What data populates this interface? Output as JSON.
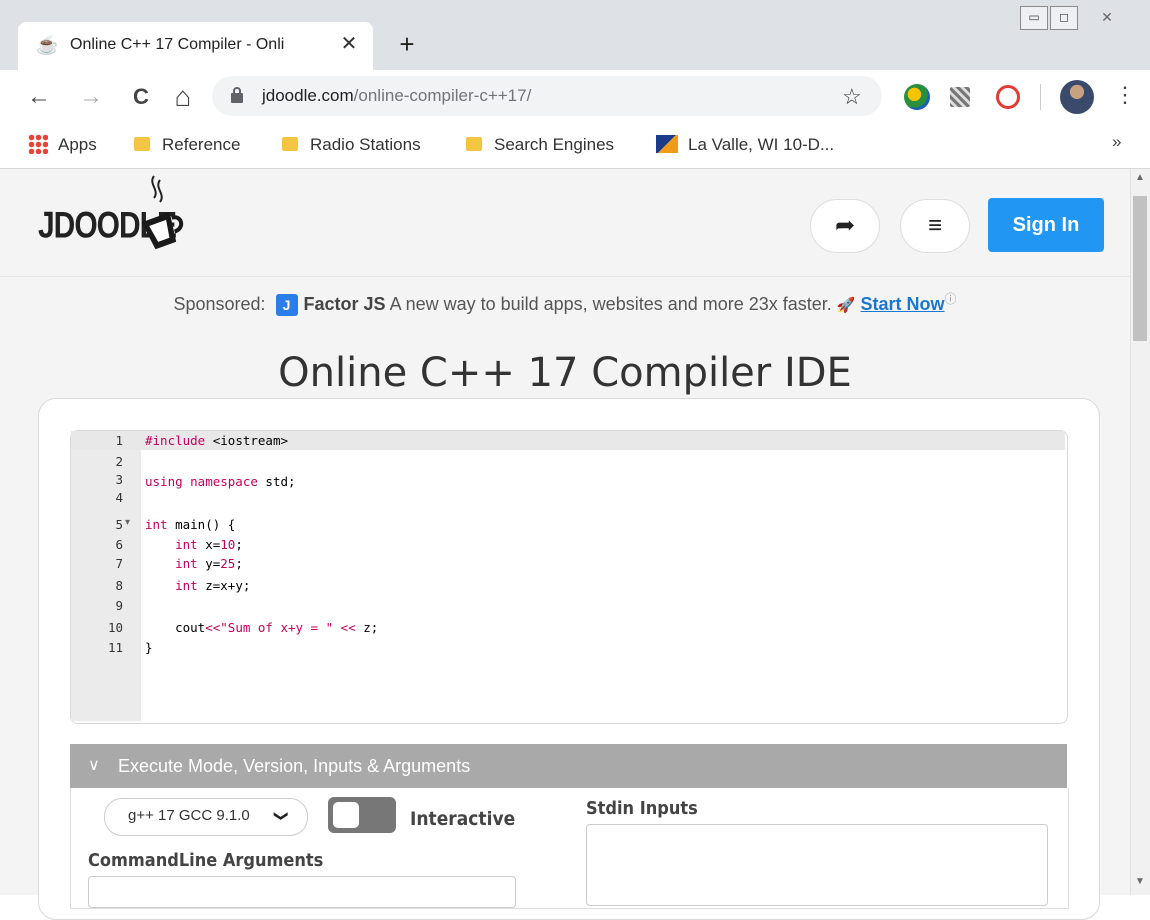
{
  "browser": {
    "tab": {
      "title": "Online C++ 17 Compiler - Onli",
      "close": "✕"
    },
    "new_tab": "+",
    "window": {
      "minimize": "▭",
      "maximize": "◻",
      "close": "✕"
    },
    "nav": {
      "back": "←",
      "forward": "→",
      "reload": "C",
      "home": "⌂"
    },
    "url": {
      "host": "jdoodle.com",
      "path": "/online-compiler-c++17/"
    },
    "star": "☆",
    "menu": "⋮",
    "bookmarks": [
      {
        "label": "Apps",
        "icon": "apps-grid-icon"
      },
      {
        "label": "Reference",
        "icon": "folder-icon"
      },
      {
        "label": "Radio Stations",
        "icon": "folder-icon"
      },
      {
        "label": "Search Engines",
        "icon": "folder-icon"
      },
      {
        "label": "La Valle, WI 10-D...",
        "icon": "weather-icon"
      }
    ],
    "bookmarks_more": "»"
  },
  "header": {
    "logo": "JDOODLE",
    "share_icon": "➦",
    "menu_icon": "≡",
    "signin": "Sign In"
  },
  "sponsored": {
    "prefix": "Sponsored:",
    "brand": "Factor JS",
    "text": "A new way to build apps, websites and more 23x faster.",
    "rocket": "🚀",
    "cta": "Start Now",
    "info": "ⓘ"
  },
  "page_title": "Online C++ 17 Compiler IDE",
  "editor": {
    "line_numbers": [
      "1",
      "2",
      "3",
      "4",
      "5",
      "6",
      "7",
      "8",
      "9",
      "10",
      "11"
    ],
    "fold_marker": "▾"
  },
  "execute": {
    "chevron": "∨",
    "title": "Execute Mode, Version, Inputs & Arguments",
    "version": "g++ 17 GCC 9.1.0",
    "version_caret": "❯",
    "interactive": "Interactive",
    "stdin_label": "Stdin Inputs",
    "cmd_label": "CommandLine Arguments"
  },
  "colors": {
    "signin_bg": "#2196f3",
    "keyword": "#c7005b",
    "exec_bar": "#a9a9a9"
  }
}
